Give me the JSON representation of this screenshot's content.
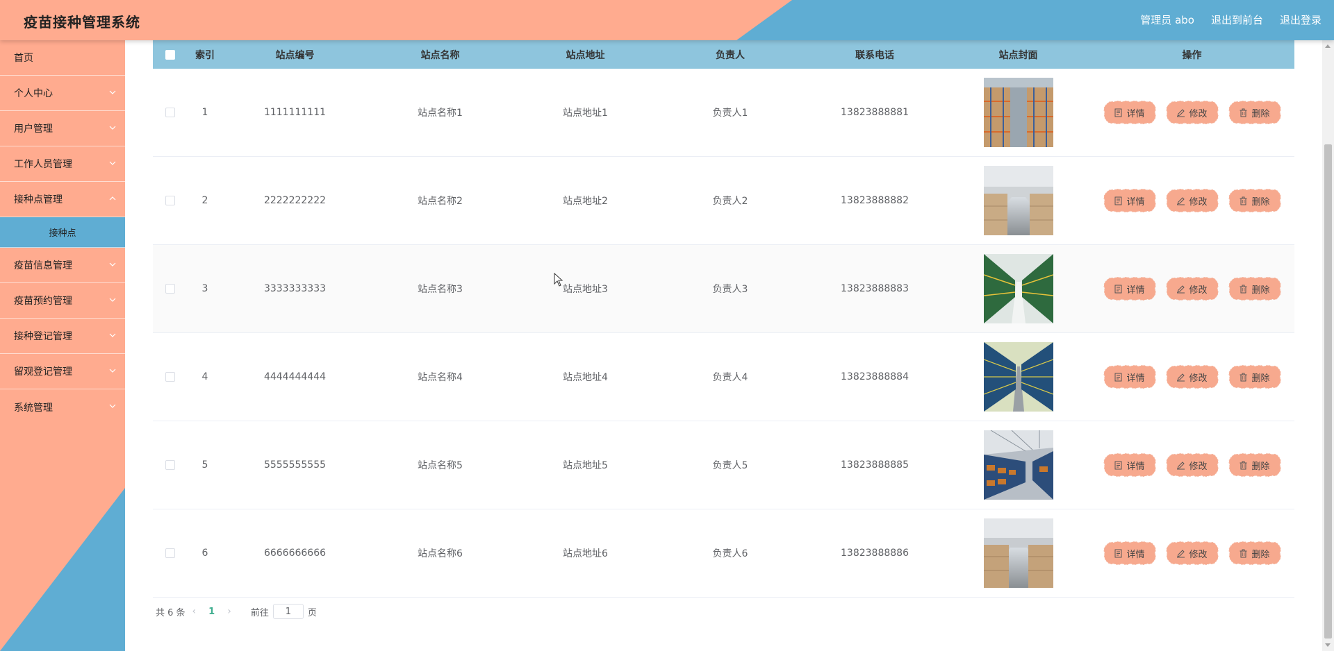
{
  "colors": {
    "salmon": "#ffab8f",
    "blue": "#5fadd3",
    "header_blue": "#8ec5dd",
    "button": "#f7a98e"
  },
  "header": {
    "title": "疫苗接种管理系统",
    "user": "管理员 abo",
    "front": "退出到前台",
    "logout": "退出登录"
  },
  "sidebar": {
    "items": [
      {
        "label": "首页",
        "icon": "none"
      },
      {
        "label": "个人中心",
        "icon": "chevron-down-icon"
      },
      {
        "label": "用户管理",
        "icon": "chevron-down-icon"
      },
      {
        "label": "工作人员管理",
        "icon": "chevron-down-icon"
      },
      {
        "label": "接种点管理",
        "icon": "chevron-down-icon",
        "expanded": true,
        "sub": "接种点"
      },
      {
        "label": "疫苗信息管理",
        "icon": "chevron-down-icon"
      },
      {
        "label": "疫苗预约管理",
        "icon": "chevron-down-icon"
      },
      {
        "label": "接种登记管理",
        "icon": "chevron-down-icon"
      },
      {
        "label": "留观登记管理",
        "icon": "chevron-down-icon"
      },
      {
        "label": "系统管理",
        "icon": "chevron-down-icon"
      }
    ]
  },
  "table": {
    "headers": [
      "索引",
      "站点编号",
      "站点名称",
      "站点地址",
      "负责人",
      "联系电话",
      "站点封面",
      "操作"
    ],
    "rows": [
      {
        "idx": "1",
        "code": "1111111111",
        "name": "站点名称1",
        "addr": "站点地址1",
        "person": "负责人1",
        "phone": "13823888881"
      },
      {
        "idx": "2",
        "code": "2222222222",
        "name": "站点名称2",
        "addr": "站点地址2",
        "person": "负责人2",
        "phone": "13823888882"
      },
      {
        "idx": "3",
        "code": "3333333333",
        "name": "站点名称3",
        "addr": "站点地址3",
        "person": "负责人3",
        "phone": "13823888883"
      },
      {
        "idx": "4",
        "code": "4444444444",
        "name": "站点名称4",
        "addr": "站点地址4",
        "person": "负责人4",
        "phone": "13823888884"
      },
      {
        "idx": "5",
        "code": "5555555555",
        "name": "站点名称5",
        "addr": "站点地址5",
        "person": "负责人5",
        "phone": "13823888885"
      },
      {
        "idx": "6",
        "code": "6666666666",
        "name": "站点名称6",
        "addr": "站点地址6",
        "person": "负责人6",
        "phone": "13823888886"
      }
    ],
    "actions": {
      "detail": "详情",
      "edit": "修改",
      "delete": "删除"
    }
  },
  "pager": {
    "total": "共 6 条",
    "current": "1",
    "goto_prefix": "前往",
    "goto_value": "1",
    "goto_suffix": "页"
  }
}
